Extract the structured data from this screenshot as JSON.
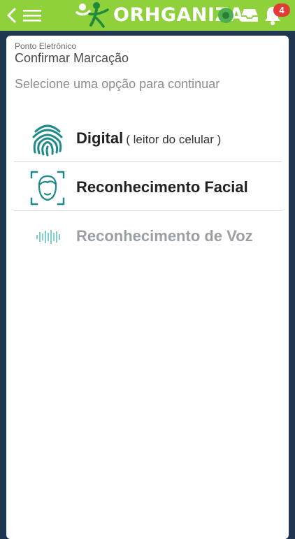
{
  "header": {
    "logo_text": "ORHGANIZA",
    "notification_count": "4",
    "bg_color": "#8fd13a",
    "badge_color": "#e53935"
  },
  "page": {
    "section_label": "Ponto Eletrônico",
    "title": "Confirmar Marcação",
    "instruction": "Selecione uma opção para continuar"
  },
  "options": [
    {
      "label": "Digital",
      "sublabel": "( leitor do celular )",
      "icon": "fingerprint-icon",
      "enabled": true
    },
    {
      "label": "Reconhecimento Facial",
      "icon": "face-scan-icon",
      "enabled": true
    },
    {
      "label": "Reconhecimento de Voz",
      "icon": "voice-wave-icon",
      "enabled": false
    }
  ],
  "colors": {
    "accent_teal": "#1f8a8a",
    "voice_icon": "#7fcfcf",
    "background": "#1e3650"
  }
}
